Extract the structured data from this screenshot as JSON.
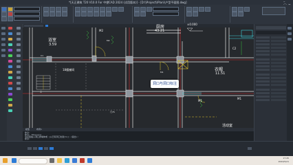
{
  "app": {
    "title": "*[天正建筑 T20 V10.0 For 中望CAD 2024 (试用版本)] - [D:\\\\Project\\\\Plan\\\\户型平面图.dwg]"
  },
  "canvas": {
    "rooms": [
      {
        "name": "浴室",
        "area": "3.59"
      },
      {
        "name": "厨房",
        "area": "43.21"
      },
      {
        "name": "衣帽",
        "area": "11.51"
      }
    ],
    "labels": {
      "stair": "18楼梯间",
      "elevation": "±0.000",
      "activity": "活动室",
      "door_m2": "M2",
      "door_m1": "M1",
      "door_m1b": "M1",
      "win_c2": "C2",
      "win_c1": "C1",
      "door_m1c": "M1",
      "door_m2b": "M2",
      "stair_dir": "上",
      "door_num": "门75"
    },
    "tooltip": "洞口与洞口标注"
  },
  "command": {
    "tabs": [
      "模型",
      "布局1"
    ],
    "lines": [
      "命令:",
      "命令: TOpening",
      "请点取插入洞口的墙体或 [从已有洞口创建(S)] <退出>:",
      "命令:"
    ]
  },
  "taskbar": {
    "time": "17:45",
    "date": "2024/5/21"
  },
  "colors": {
    "wall": "#e8e8e8",
    "axis_red": "#d92b2b",
    "door_yellow": "#e0c32a",
    "window_cyan": "#3ed4e0",
    "dim_green": "#39c23f",
    "accent_blue": "#2d7bd6"
  }
}
